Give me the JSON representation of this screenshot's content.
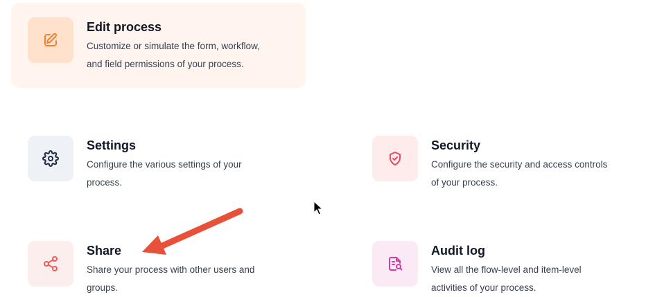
{
  "colors": {
    "edit_bg": "#fff4ee",
    "edit_icon_bg": "#ffe1cc",
    "edit_icon": "#f0822e",
    "settings_icon_bg": "#eef1f6",
    "settings_icon": "#1f2a44",
    "security_icon_bg": "#fdeceb",
    "security_icon": "#e84a5f",
    "share_icon_bg": "#fdeeee",
    "share_icon": "#ef5a5a",
    "audit_icon_bg": "#fbeaf5",
    "audit_icon": "#d63aa6",
    "annotation_arrow": "#e8503a"
  },
  "cards": {
    "edit_process": {
      "icon": "edit-icon",
      "title": "Edit process",
      "desc_line1": "Customize or simulate the form, workflow,",
      "desc_line2": "and field permissions of your process."
    },
    "settings": {
      "icon": "gear-icon",
      "title": "Settings",
      "desc_line1": "Configure the various settings of your",
      "desc_line2": "process."
    },
    "security": {
      "icon": "shield-check-icon",
      "title": "Security",
      "desc_line1": "Configure the security and access controls",
      "desc_line2": "of your process."
    },
    "share": {
      "icon": "share-icon",
      "title": "Share",
      "desc_line1": "Share your process with other users and",
      "desc_line2": "groups."
    },
    "audit_log": {
      "icon": "document-search-icon",
      "title": "Audit log",
      "desc_line1": "View all the flow-level and item-level",
      "desc_line2": "activities of your process."
    }
  }
}
